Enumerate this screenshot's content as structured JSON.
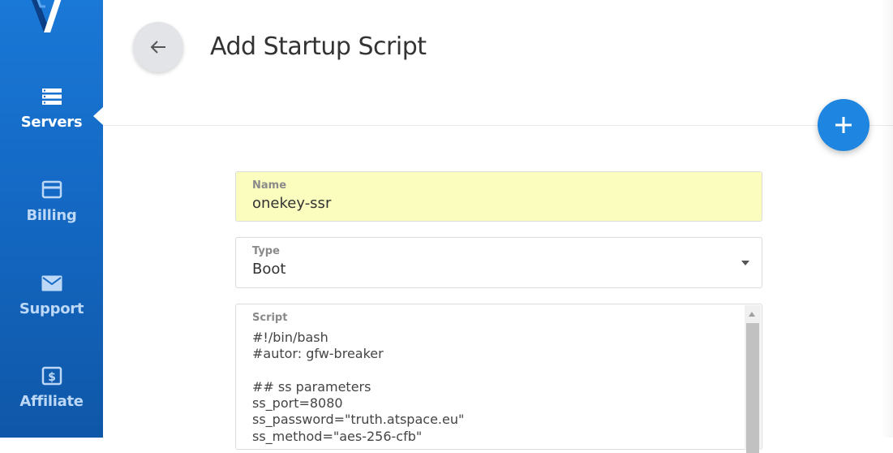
{
  "sidebar": {
    "items": [
      {
        "label": "Servers",
        "icon": "server-icon",
        "active": true
      },
      {
        "label": "Billing",
        "icon": "credit-card-icon",
        "active": false
      },
      {
        "label": "Support",
        "icon": "envelope-icon",
        "active": false
      },
      {
        "label": "Affiliate",
        "icon": "dollar-icon",
        "active": false
      }
    ]
  },
  "header": {
    "title": "Add Startup Script"
  },
  "form": {
    "name": {
      "label": "Name",
      "value": "onekey-ssr"
    },
    "type": {
      "label": "Type",
      "value": "Boot"
    },
    "script": {
      "label": "Script",
      "value": "#!/bin/bash\n#autor: gfw-breaker\n\n## ss parameters\nss_port=8080\nss_password=\"truth.atspace.eu\"\nss_method=\"aes-256-cfb\""
    }
  },
  "colors": {
    "sidebar_bg": "#1469c4",
    "accent": "#1e86e0",
    "autofill_bg": "#fafdbd",
    "title_text": "#333333"
  }
}
